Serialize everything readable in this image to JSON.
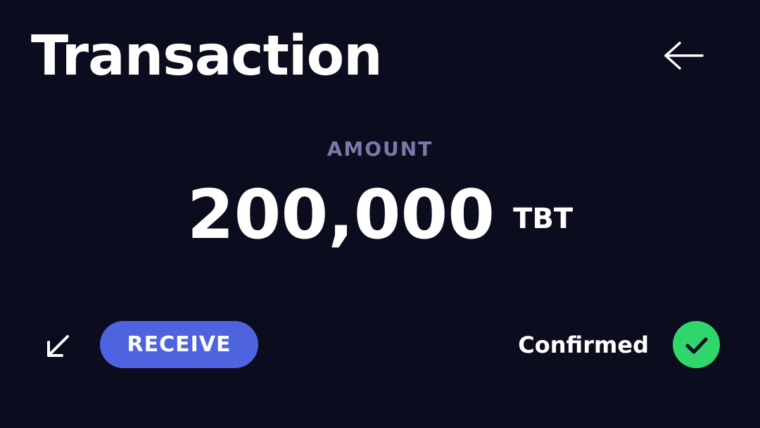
{
  "header": {
    "title": "Transaction",
    "back_icon": "arrow-left-icon"
  },
  "amount": {
    "label": "AMOUNT",
    "value": "200,000",
    "unit": "TBT"
  },
  "transaction": {
    "direction_icon": "arrow-down-left-icon",
    "type_label": "RECEIVE",
    "type_color": "#4d63df",
    "status_label": "Confirmed",
    "status_icon": "check-circle-icon",
    "status_color": "#2ed66b"
  },
  "colors": {
    "background": "#0b0c1e",
    "text": "#ffffff",
    "muted": "#7a7aa8"
  }
}
